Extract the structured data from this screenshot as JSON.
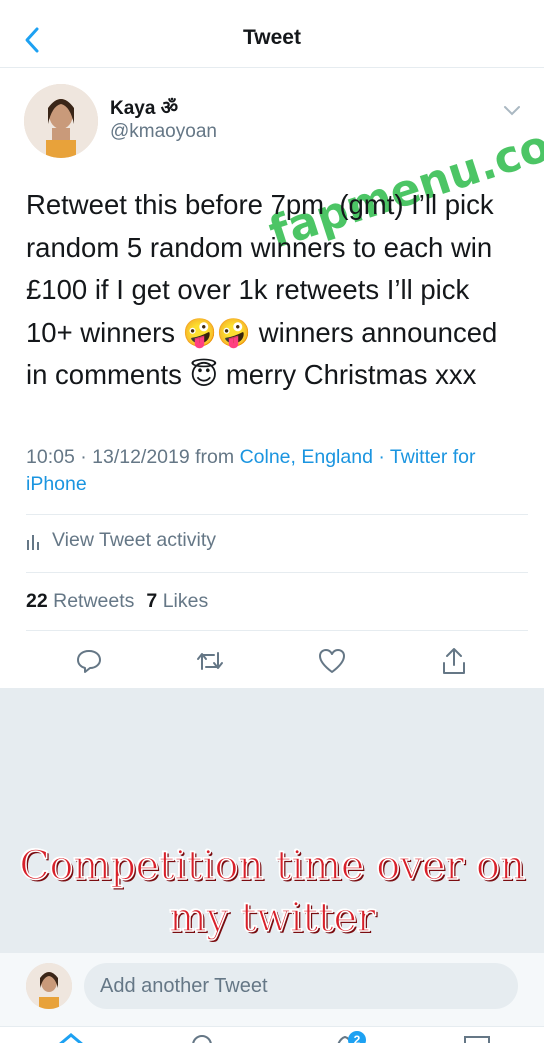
{
  "header": {
    "title": "Tweet",
    "back_icon": "chevron-left-icon"
  },
  "author": {
    "name": "Kaya ॐ",
    "handle": "@kmaoyoan"
  },
  "watermark": "fapmenu.com",
  "tweet": {
    "text": "Retweet this before 7pm  (gmt) I’ll pick\nrandom 5 random winners to each win\n£100 if I get over 1k retweets I’ll pick\n10+ winners 🤪🤪 winners announced\nin comments 😇 merry Christmas xxx",
    "time": "10:05 · 13/12/2019 from ",
    "location": "Colne, England",
    "source": "· Twitter for iPhone"
  },
  "activity": {
    "label": "View Tweet activity",
    "icon": "bar-chart-icon"
  },
  "stats": {
    "retweets_count": "22",
    "retweets_label": "Retweets",
    "likes_count": "7",
    "likes_label": "Likes"
  },
  "actions": [
    "reply-icon",
    "retweet-icon",
    "like-icon",
    "share-icon"
  ],
  "caption": {
    "line1": "Competition time over on",
    "line2": "my twitter"
  },
  "reply": {
    "placeholder": "Add another Tweet"
  },
  "tabbar": {
    "notification_badge": "2"
  },
  "colors": {
    "accent": "#1da1f2",
    "link": "#1b95e0",
    "muted": "#657786",
    "caption": "#d8202a",
    "watermark": "#2dbb4a"
  }
}
